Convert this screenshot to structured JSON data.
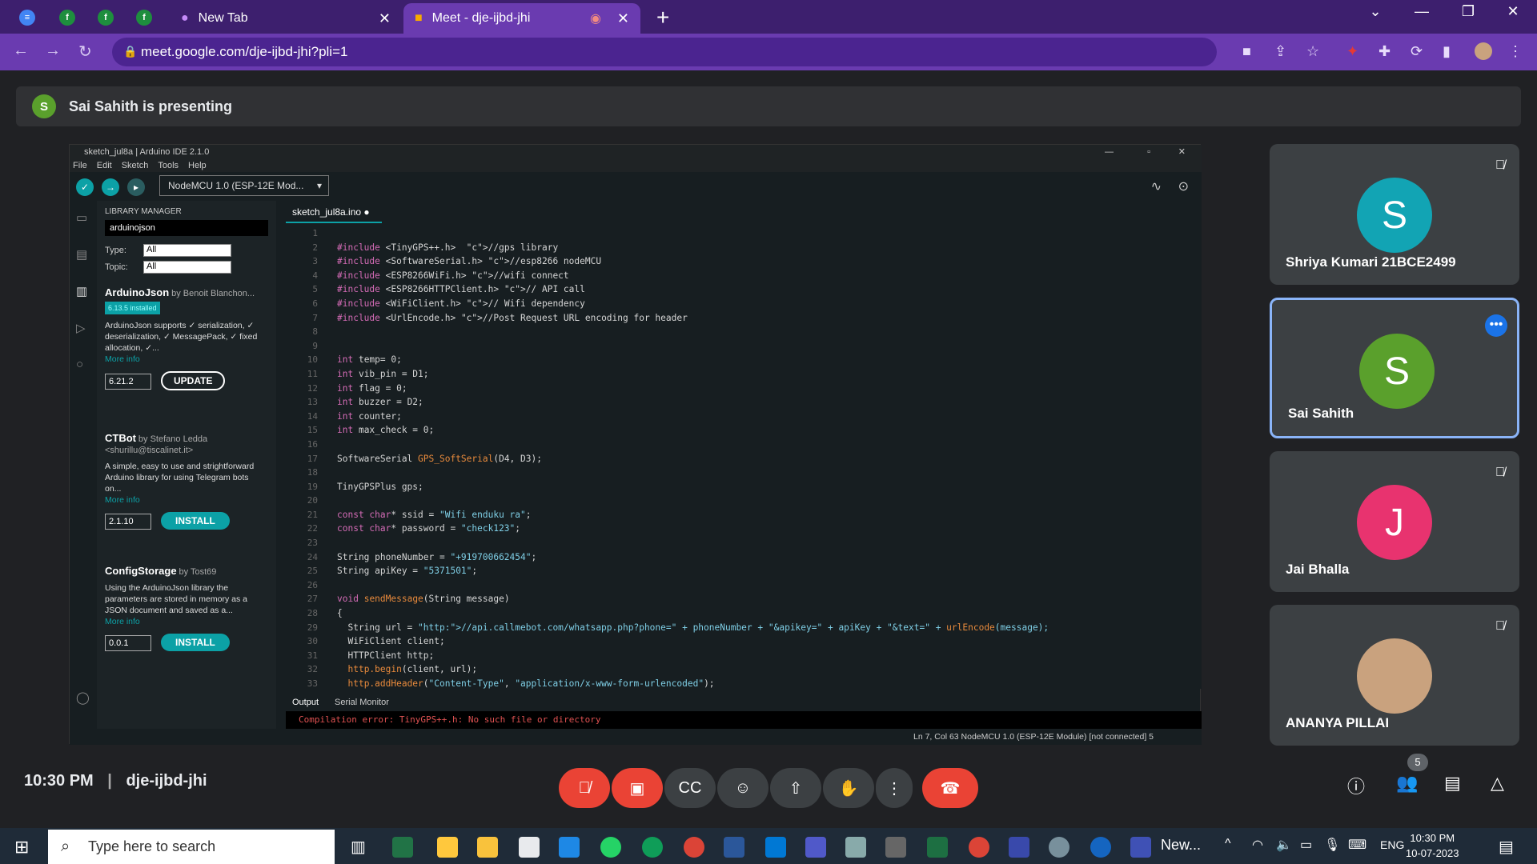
{
  "browser": {
    "tabs": [
      {
        "label": "New Tab"
      },
      {
        "label": "Meet - dje-ijbd-jhi"
      }
    ],
    "url": "meet.google.com/dje-ijbd-jhi?pli=1"
  },
  "meet": {
    "presenter_initial": "S",
    "presenting_text": "Sai Sahith is presenting",
    "time": "10:30 PM",
    "meeting_code": "dje-ijbd-jhi",
    "people_count": "5",
    "participants": [
      {
        "initial": "S",
        "name": "Shriya Kumari 21BCE2499",
        "color": "#12a4b4"
      },
      {
        "initial": "S",
        "name": "Sai Sahith",
        "color": "#5aa02c"
      },
      {
        "initial": "J",
        "name": "Jai Bhalla",
        "color": "#e8336f"
      },
      {
        "initial": "",
        "name": "ANANYA PILLAI",
        "color": "#c9a27e"
      }
    ]
  },
  "ide": {
    "title": "sketch_jul8a | Arduino IDE 2.1.0",
    "menu": [
      "File",
      "Edit",
      "Sketch",
      "Tools",
      "Help"
    ],
    "board": "NodeMCU 1.0 (ESP-12E Mod...",
    "library_manager_title": "LIBRARY MANAGER",
    "search_value": "arduinojson",
    "type_label": "Type:",
    "type_value": "All",
    "topic_label": "Topic:",
    "topic_value": "All",
    "libraries": [
      {
        "name": "ArduinoJson",
        "by": "by Benoit Blanchon...",
        "installed": "6.13.5 installed",
        "desc": "ArduinoJson supports ✓ serialization, ✓ deserialization, ✓ MessagePack, ✓ fixed allocation, ✓...",
        "more": "More info",
        "version": "6.21.2",
        "action": "UPDATE"
      },
      {
        "name": "CTBot",
        "by": "by Stefano Ledda <shurillu@tiscalinet.it>",
        "installed": "",
        "desc": "A simple, easy to use and strightforward Arduino library for using Telegram bots on...",
        "more": "More info",
        "version": "2.1.10",
        "action": "INSTALL"
      },
      {
        "name": "ConfigStorage",
        "by": "by Tost69",
        "installed": "",
        "desc": "Using the ArduinoJson library the parameters are stored in memory as a JSON document and saved as a...",
        "more": "More info",
        "version": "0.0.1",
        "action": "INSTALL"
      }
    ],
    "file_tab": "sketch_jul8a.ino",
    "line_numbers": "1\n2\n3\n4\n5\n6\n7\n8\n9\n10\n11\n12\n13\n14\n15\n16\n17\n18\n19\n20\n21\n22\n23\n24\n25\n26\n27\n28\n29\n30\n31\n32\n33",
    "code_lines": [
      "",
      "#include <TinyGPS++.h>  //gps library",
      "#include <SoftwareSerial.h> //esp8266 nodeMCU",
      "#include <ESP8266WiFi.h> //wifi connect",
      "#include <ESP8266HTTPClient.h> // API call",
      "#include <WiFiClient.h> // Wifi dependency",
      "#include <UrlEncode.h> //Post Request URL encoding for header",
      "",
      "",
      "int temp= 0;",
      "int vib_pin = D1;",
      "int flag = 0;",
      "int buzzer = D2;",
      "int counter;",
      "int max_check = 0;",
      "",
      "SoftwareSerial GPS_SoftSerial(D4, D3);",
      "",
      "TinyGPSPlus gps;",
      "",
      "const char* ssid = \"Wifi enduku ra\";",
      "const char* password = \"check123\";",
      "",
      "String phoneNumber = \"+919700662454\";",
      "String apiKey = \"5371501\";",
      "",
      "void sendMessage(String message)",
      "{",
      "  String url = \"http://api.callmebot.com/whatsapp.php?phone=\" + phoneNumber + \"&apikey=\" + apiKey + \"&text=\" + urlEncode(message);",
      "  WiFiClient client;",
      "  HTTPClient http;",
      "  http.begin(client, url);",
      "  http.addHeader(\"Content-Type\", \"application/x-www-form-urlencoded\");"
    ],
    "output_tab": "Output",
    "serial_tab": "Serial Monitor",
    "error": "Compilation error: TinyGPS++.h: No such file or directory",
    "status": "Ln 7, Col 63    NodeMCU 1.0 (ESP-12E Module) [not connected]   5"
  },
  "taskbar": {
    "search_placeholder": "Type here to search",
    "app_label": "New...",
    "lang": "ENG",
    "time": "10:30 PM",
    "date": "10-07-2023"
  }
}
